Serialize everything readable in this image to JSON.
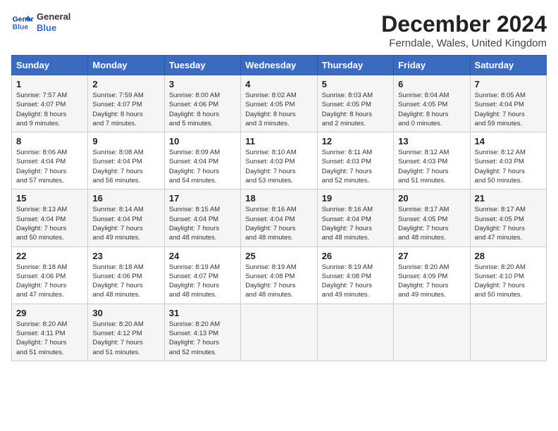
{
  "header": {
    "logo_line1": "General",
    "logo_line2": "Blue",
    "title": "December 2024",
    "subtitle": "Ferndale, Wales, United Kingdom"
  },
  "weekdays": [
    "Sunday",
    "Monday",
    "Tuesday",
    "Wednesday",
    "Thursday",
    "Friday",
    "Saturday"
  ],
  "weeks": [
    [
      {
        "day": "1",
        "info": "Sunrise: 7:57 AM\nSunset: 4:07 PM\nDaylight: 8 hours\nand 9 minutes."
      },
      {
        "day": "2",
        "info": "Sunrise: 7:59 AM\nSunset: 4:07 PM\nDaylight: 8 hours\nand 7 minutes."
      },
      {
        "day": "3",
        "info": "Sunrise: 8:00 AM\nSunset: 4:06 PM\nDaylight: 8 hours\nand 5 minutes."
      },
      {
        "day": "4",
        "info": "Sunrise: 8:02 AM\nSunset: 4:05 PM\nDaylight: 8 hours\nand 3 minutes."
      },
      {
        "day": "5",
        "info": "Sunrise: 8:03 AM\nSunset: 4:05 PM\nDaylight: 8 hours\nand 2 minutes."
      },
      {
        "day": "6",
        "info": "Sunrise: 8:04 AM\nSunset: 4:05 PM\nDaylight: 8 hours\nand 0 minutes."
      },
      {
        "day": "7",
        "info": "Sunrise: 8:05 AM\nSunset: 4:04 PM\nDaylight: 7 hours\nand 59 minutes."
      }
    ],
    [
      {
        "day": "8",
        "info": "Sunrise: 8:06 AM\nSunset: 4:04 PM\nDaylight: 7 hours\nand 57 minutes."
      },
      {
        "day": "9",
        "info": "Sunrise: 8:08 AM\nSunset: 4:04 PM\nDaylight: 7 hours\nand 56 minutes."
      },
      {
        "day": "10",
        "info": "Sunrise: 8:09 AM\nSunset: 4:04 PM\nDaylight: 7 hours\nand 54 minutes."
      },
      {
        "day": "11",
        "info": "Sunrise: 8:10 AM\nSunset: 4:03 PM\nDaylight: 7 hours\nand 53 minutes."
      },
      {
        "day": "12",
        "info": "Sunrise: 8:11 AM\nSunset: 4:03 PM\nDaylight: 7 hours\nand 52 minutes."
      },
      {
        "day": "13",
        "info": "Sunrise: 8:12 AM\nSunset: 4:03 PM\nDaylight: 7 hours\nand 51 minutes."
      },
      {
        "day": "14",
        "info": "Sunrise: 8:12 AM\nSunset: 4:03 PM\nDaylight: 7 hours\nand 50 minutes."
      }
    ],
    [
      {
        "day": "15",
        "info": "Sunrise: 8:13 AM\nSunset: 4:04 PM\nDaylight: 7 hours\nand 50 minutes."
      },
      {
        "day": "16",
        "info": "Sunrise: 8:14 AM\nSunset: 4:04 PM\nDaylight: 7 hours\nand 49 minutes."
      },
      {
        "day": "17",
        "info": "Sunrise: 8:15 AM\nSunset: 4:04 PM\nDaylight: 7 hours\nand 48 minutes."
      },
      {
        "day": "18",
        "info": "Sunrise: 8:16 AM\nSunset: 4:04 PM\nDaylight: 7 hours\nand 48 minutes."
      },
      {
        "day": "19",
        "info": "Sunrise: 8:16 AM\nSunset: 4:04 PM\nDaylight: 7 hours\nand 48 minutes."
      },
      {
        "day": "20",
        "info": "Sunrise: 8:17 AM\nSunset: 4:05 PM\nDaylight: 7 hours\nand 48 minutes."
      },
      {
        "day": "21",
        "info": "Sunrise: 8:17 AM\nSunset: 4:05 PM\nDaylight: 7 hours\nand 47 minutes."
      }
    ],
    [
      {
        "day": "22",
        "info": "Sunrise: 8:18 AM\nSunset: 4:06 PM\nDaylight: 7 hours\nand 47 minutes."
      },
      {
        "day": "23",
        "info": "Sunrise: 8:18 AM\nSunset: 4:06 PM\nDaylight: 7 hours\nand 48 minutes."
      },
      {
        "day": "24",
        "info": "Sunrise: 8:19 AM\nSunset: 4:07 PM\nDaylight: 7 hours\nand 48 minutes."
      },
      {
        "day": "25",
        "info": "Sunrise: 8:19 AM\nSunset: 4:08 PM\nDaylight: 7 hours\nand 48 minutes."
      },
      {
        "day": "26",
        "info": "Sunrise: 8:19 AM\nSunset: 4:08 PM\nDaylight: 7 hours\nand 49 minutes."
      },
      {
        "day": "27",
        "info": "Sunrise: 8:20 AM\nSunset: 4:09 PM\nDaylight: 7 hours\nand 49 minutes."
      },
      {
        "day": "28",
        "info": "Sunrise: 8:20 AM\nSunset: 4:10 PM\nDaylight: 7 hours\nand 50 minutes."
      }
    ],
    [
      {
        "day": "29",
        "info": "Sunrise: 8:20 AM\nSunset: 4:11 PM\nDaylight: 7 hours\nand 51 minutes."
      },
      {
        "day": "30",
        "info": "Sunrise: 8:20 AM\nSunset: 4:12 PM\nDaylight: 7 hours\nand 51 minutes."
      },
      {
        "day": "31",
        "info": "Sunrise: 8:20 AM\nSunset: 4:13 PM\nDaylight: 7 hours\nand 52 minutes."
      },
      null,
      null,
      null,
      null
    ]
  ]
}
